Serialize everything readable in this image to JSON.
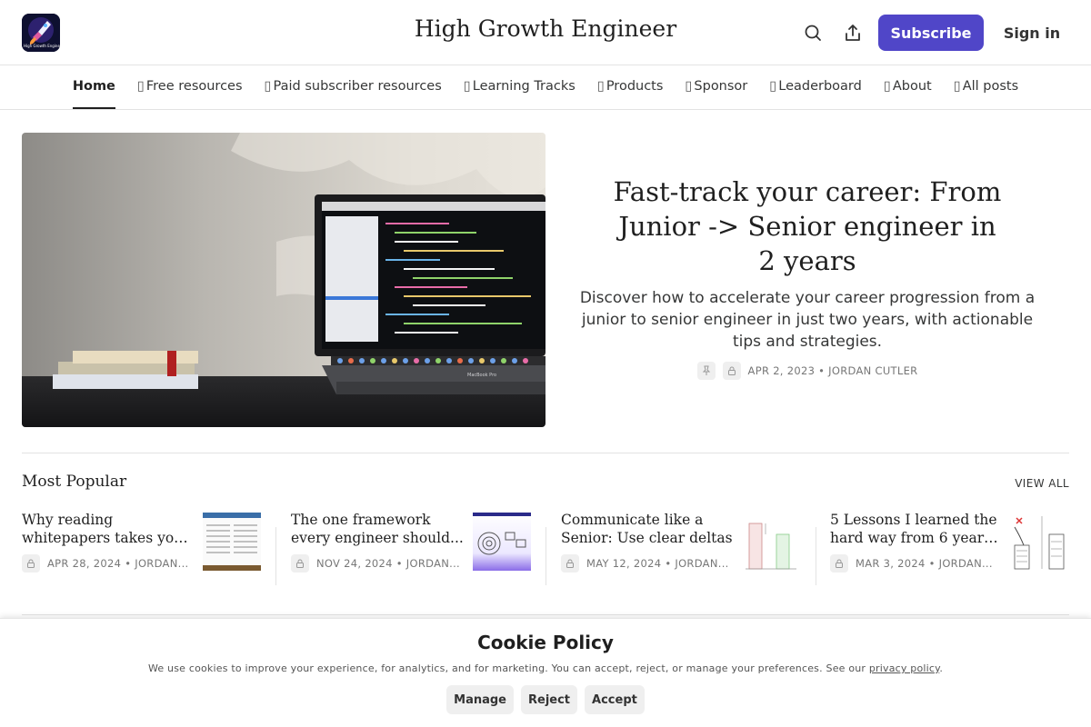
{
  "header": {
    "site_title": "High Growth Engineer",
    "logo_text": "High Growth Engineer",
    "subscribe_label": "Subscribe",
    "signin_label": "Sign in",
    "accent_color": "#5046c8"
  },
  "nav": {
    "items": [
      {
        "label": "Home",
        "glyph": ""
      },
      {
        "label": "Free resources",
        "glyph": "▯"
      },
      {
        "label": "Paid subscriber resources",
        "glyph": "▯"
      },
      {
        "label": "Learning Tracks",
        "glyph": "▯"
      },
      {
        "label": "Products",
        "glyph": "▯"
      },
      {
        "label": "Sponsor",
        "glyph": "▯"
      },
      {
        "label": "Leaderboard",
        "glyph": "▯"
      },
      {
        "label": "About",
        "glyph": "▯"
      },
      {
        "label": "All posts",
        "glyph": "▯"
      }
    ]
  },
  "hero": {
    "title": "Fast-track your career: From Junior -> Senior engineer in 2 years",
    "subtitle": "Discover how to accelerate your career progression from a junior to senior engineer in just two years, with actionable tips and strategies.",
    "meta": "APR 2, 2023 • JORDAN CUTLER",
    "laptop_label": "MacBook Pro"
  },
  "most_popular": {
    "heading": "Most Popular",
    "view_all": "VIEW ALL",
    "posts": [
      {
        "line1": "Why reading",
        "line2": "whitepapers takes you...",
        "meta": "APR 28, 2024 • JORDAN..."
      },
      {
        "line1": "The one framework",
        "line2": "every engineer should...",
        "meta": "NOV 24, 2024 • JORDAN..."
      },
      {
        "line1": "Communicate like a",
        "line2": "Senior: Use clear deltas",
        "meta": "MAY 12, 2024 • JORDAN..."
      },
      {
        "line1": "5 Lessons I learned the",
        "line2": "hard way from 6 years...",
        "meta": "MAR 3, 2024 • JORDAN..."
      }
    ]
  },
  "cookie": {
    "title": "Cookie Policy",
    "text": "We use cookies to improve your experience, for analytics, and for marketing. You can accept, reject, or manage your preferences. See our ",
    "link": "privacy policy",
    "after": ".",
    "manage": "Manage",
    "reject": "Reject",
    "accept": "Accept"
  }
}
